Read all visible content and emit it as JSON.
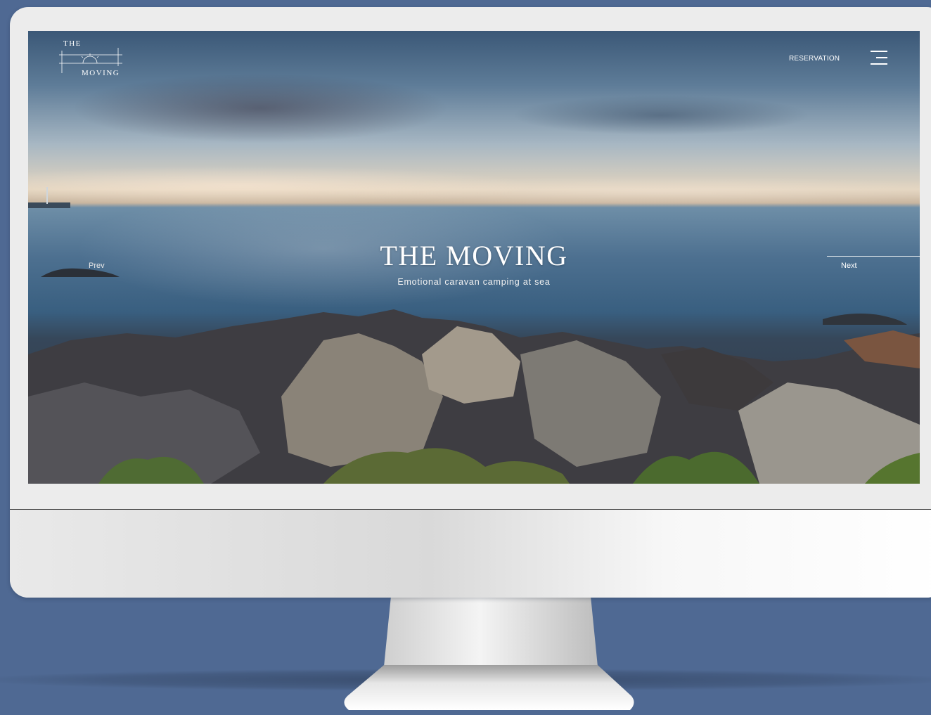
{
  "logo": {
    "line1": "THE",
    "line2": "MOVING"
  },
  "nav": {
    "reservation": "RESERVATION",
    "menu_icon": "hamburger-menu-icon"
  },
  "hero": {
    "title": "THE MOVING",
    "subtitle": "Emotional caravan camping at sea"
  },
  "slider": {
    "prev_label": "Prev",
    "next_label": "Next"
  },
  "colors": {
    "background": "#4f6993",
    "bezel": "#ececec",
    "text": "#ffffff"
  }
}
